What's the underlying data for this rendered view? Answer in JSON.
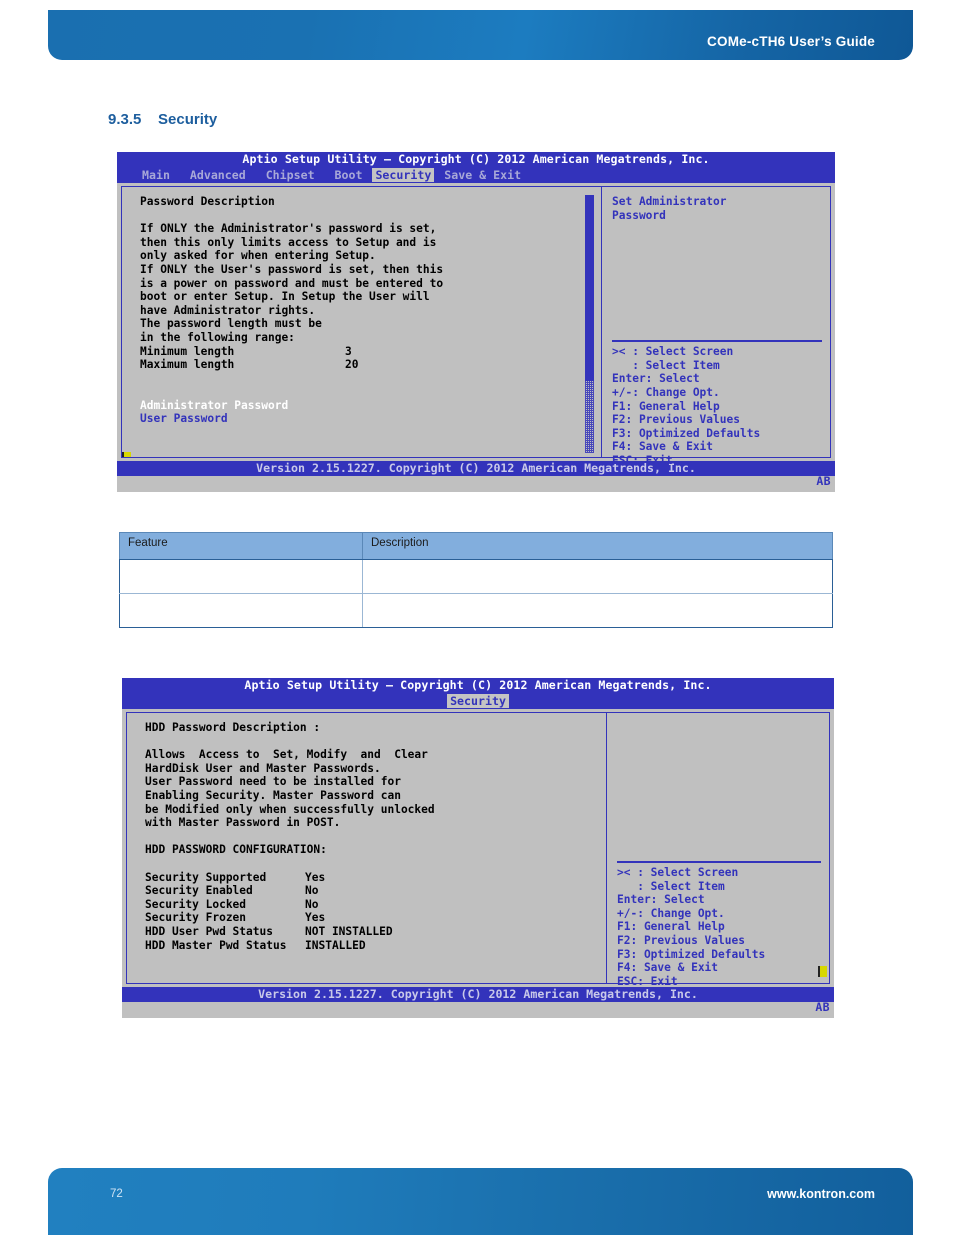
{
  "page": {
    "header_title": "COMe-cTH6 User’s Guide",
    "footer_page_number": "72",
    "footer_url": "www.kontron.com",
    "accent_blue": "#1a6fb0",
    "bios_blue": "#3333bb",
    "bios_gray": "#c0c0c0"
  },
  "section": {
    "number": "9.3.5",
    "title": "Security"
  },
  "bios_screen_1": {
    "title": "Aptio Setup Utility – Copyright (C) 2012 American Megatrends, Inc.",
    "menu_tabs": [
      {
        "label": "Main",
        "active": false
      },
      {
        "label": "Advanced",
        "active": false
      },
      {
        "label": "Chipset",
        "active": false
      },
      {
        "label": "Boot",
        "active": false
      },
      {
        "label": "Security",
        "active": true
      },
      {
        "label": "Save & Exit",
        "active": false
      }
    ],
    "left_panel": {
      "heading": "Password Description",
      "description": "If ONLY the Administrator's password is set,\nthen this only limits access to Setup and is\nonly asked for when entering Setup.\nIf ONLY the User's password is set, then this\nis a power on password and must be entered to\nboot or enter Setup. In Setup the User will\nhave Administrator rights.\nThe password length must be\nin the following range:",
      "length_rows": [
        {
          "label": "Minimum length",
          "value": "3"
        },
        {
          "label": "Maximum length",
          "value": "20"
        }
      ],
      "items": [
        {
          "label": "Administrator Password",
          "selected": true
        },
        {
          "label": "User Password",
          "selected": false
        }
      ]
    },
    "right_panel": {
      "help_text": "Set Administrator\nPassword",
      "key_legend": ">< : Select Screen\n   : Select Item\nEnter: Select\n+/-: Change Opt.\nF1: General Help\nF2: Previous Values\nF3: Optimized Defaults\nF4: Save & Exit\nESC: Exit"
    },
    "footer": "Version 2.15.1227. Copyright (C) 2012 American Megatrends, Inc.",
    "badge": "AB"
  },
  "feature_table": {
    "columns": [
      "Feature",
      "Description"
    ],
    "rows": [
      [
        "",
        ""
      ],
      [
        "",
        ""
      ]
    ]
  },
  "bios_screen_2": {
    "title": "Aptio Setup Utility – Copyright (C) 2012 American Megatrends, Inc.",
    "menu_tabs": [
      {
        "label": "Security",
        "active": true
      }
    ],
    "left_panel": {
      "heading": "HDD Password Description :",
      "description": "Allows  Access to  Set, Modify  and  Clear\nHardDisk User and Master Passwords.\nUser Password need to be installed for\nEnabling Security. Master Password can\nbe Modified only when successfully unlocked\nwith Master Password in POST.",
      "config_heading": "HDD PASSWORD CONFIGURATION:",
      "config_rows": [
        {
          "label": "Security Supported",
          "value": "Yes"
        },
        {
          "label": "Security Enabled",
          "value": "No"
        },
        {
          "label": "Security Locked",
          "value": "No"
        },
        {
          "label": "Security Frozen",
          "value": "Yes"
        },
        {
          "label": "HDD User Pwd Status",
          "value": "NOT INSTALLED"
        },
        {
          "label": "HDD Master Pwd Status",
          "value": "INSTALLED"
        }
      ]
    },
    "right_panel": {
      "help_text": "",
      "key_legend": ">< : Select Screen\n   : Select Item\nEnter: Select\n+/-: Change Opt.\nF1: General Help\nF2: Previous Values\nF3: Optimized Defaults\nF4: Save & Exit\nESC: Exit"
    },
    "footer": "Version 2.15.1227. Copyright (C) 2012 American Megatrends, Inc.",
    "badge": "AB"
  }
}
